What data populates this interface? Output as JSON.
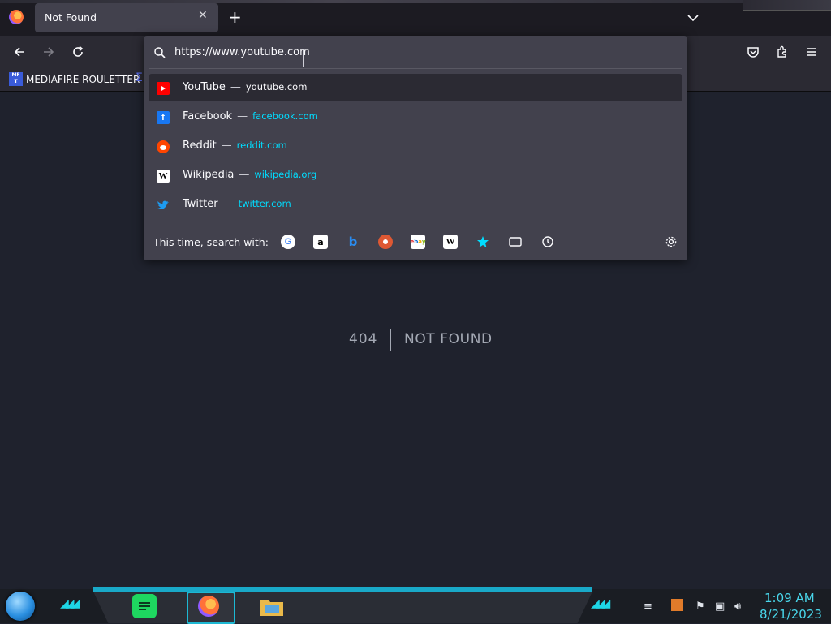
{
  "tab": {
    "title": "Not Found",
    "close": "✕",
    "new_tab": "+"
  },
  "navbar": {
    "back": "←",
    "forward": "→",
    "reload": "⟳"
  },
  "bookmarks": {
    "items": [
      {
        "label": "MEDIAFIRE ROULETTER",
        "icon_text": "MF\nT"
      }
    ]
  },
  "urlbar": {
    "value": "https://www.youtube.com",
    "suggestions": [
      {
        "title": "YouTube",
        "url": "youtube.com",
        "icon": "youtube-icon",
        "color": "#ff0000"
      },
      {
        "title": "Facebook",
        "url": "facebook.com",
        "icon": "facebook-icon",
        "color": "#1877f2"
      },
      {
        "title": "Reddit",
        "url": "reddit.com",
        "icon": "reddit-icon",
        "color": "#ff4500"
      },
      {
        "title": "Wikipedia",
        "url": "wikipedia.org",
        "icon": "wikipedia-icon",
        "color": "#ffffff"
      },
      {
        "title": "Twitter",
        "url": "twitter.com",
        "icon": "twitter-icon",
        "color": "#1d9bf0"
      }
    ],
    "dash": "—",
    "search_with_label": "This time, search with:",
    "engines": [
      "google-icon",
      "amazon-icon",
      "bing-icon",
      "duckduckgo-icon",
      "ebay-icon",
      "wikipedia-icon",
      "bookmarks-star-icon",
      "tabs-icon",
      "history-icon"
    ],
    "accent": "#00ddff"
  },
  "page": {
    "code": "404",
    "message": "NOT FOUND"
  },
  "taskbar": {
    "time": "1:09 AM",
    "date": "8/21/2023"
  }
}
